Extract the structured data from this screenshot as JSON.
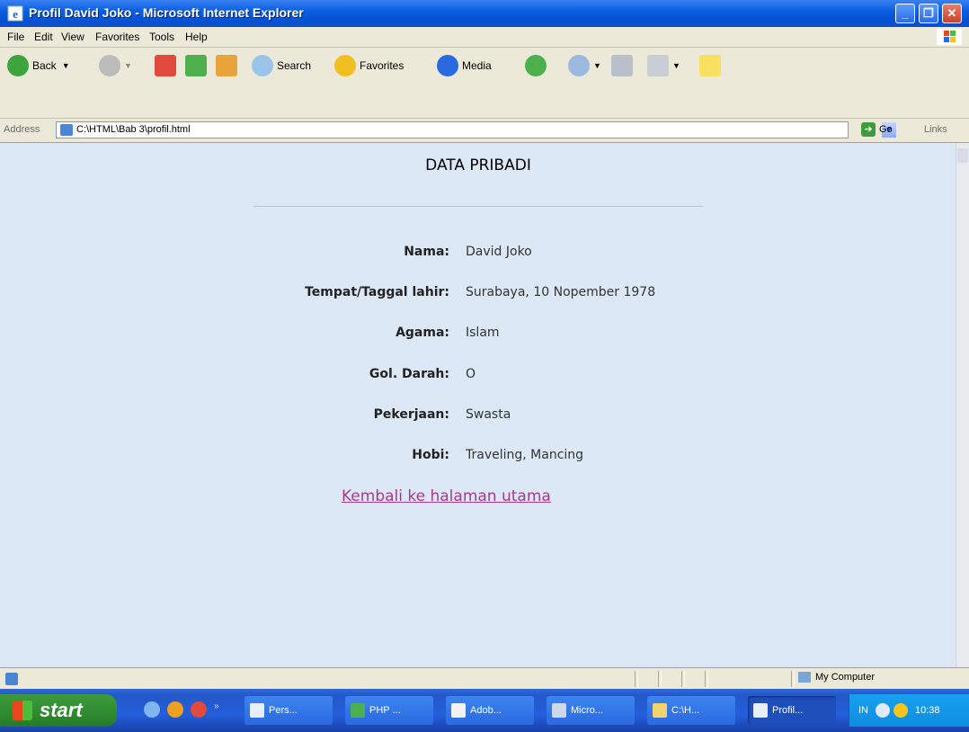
{
  "window": {
    "title": "Profil David Joko - Microsoft Internet Explorer",
    "min_label": "_",
    "max_label": "❐",
    "close_label": "✕"
  },
  "menu": [
    "File",
    "Edit",
    "View",
    "Favorites",
    "Tools",
    "Help"
  ],
  "toolbar": {
    "back_label": "Back",
    "search_label": "Search",
    "favorites_label": "Favorites",
    "media_label": "Media"
  },
  "address": {
    "label": "Address",
    "url": "C:\\HTML\\Bab 3\\profil.html",
    "go_label": "Go",
    "links_label": "Links"
  },
  "page": {
    "heading": "DATA PRIBADI",
    "rows": [
      {
        "label": "Nama:",
        "value": "David Joko"
      },
      {
        "label": "Tempat/Taggal lahir:",
        "value": "Surabaya, 10 Nopember 1978"
      },
      {
        "label": "Agama:",
        "value": "Islam"
      },
      {
        "label": "Gol. Darah:",
        "value": "O"
      },
      {
        "label": "Pekerjaan:",
        "value": "Swasta"
      },
      {
        "label": "Hobi:",
        "value": "Traveling, Mancing"
      }
    ],
    "back_link": "Kembali ke halaman utama"
  },
  "status": {
    "zone": "My Computer"
  },
  "taskbar": {
    "start_label": "start",
    "tasks": [
      "Pers...",
      "PHP ...",
      "Adob...",
      "Micro...",
      "C:\\H...",
      "Profil..."
    ],
    "lang": "IN",
    "clock": "10:38"
  },
  "colors": {
    "content_bg": "#dce8f5",
    "link": "#a83a8c",
    "titlebar": "#0553d6"
  }
}
